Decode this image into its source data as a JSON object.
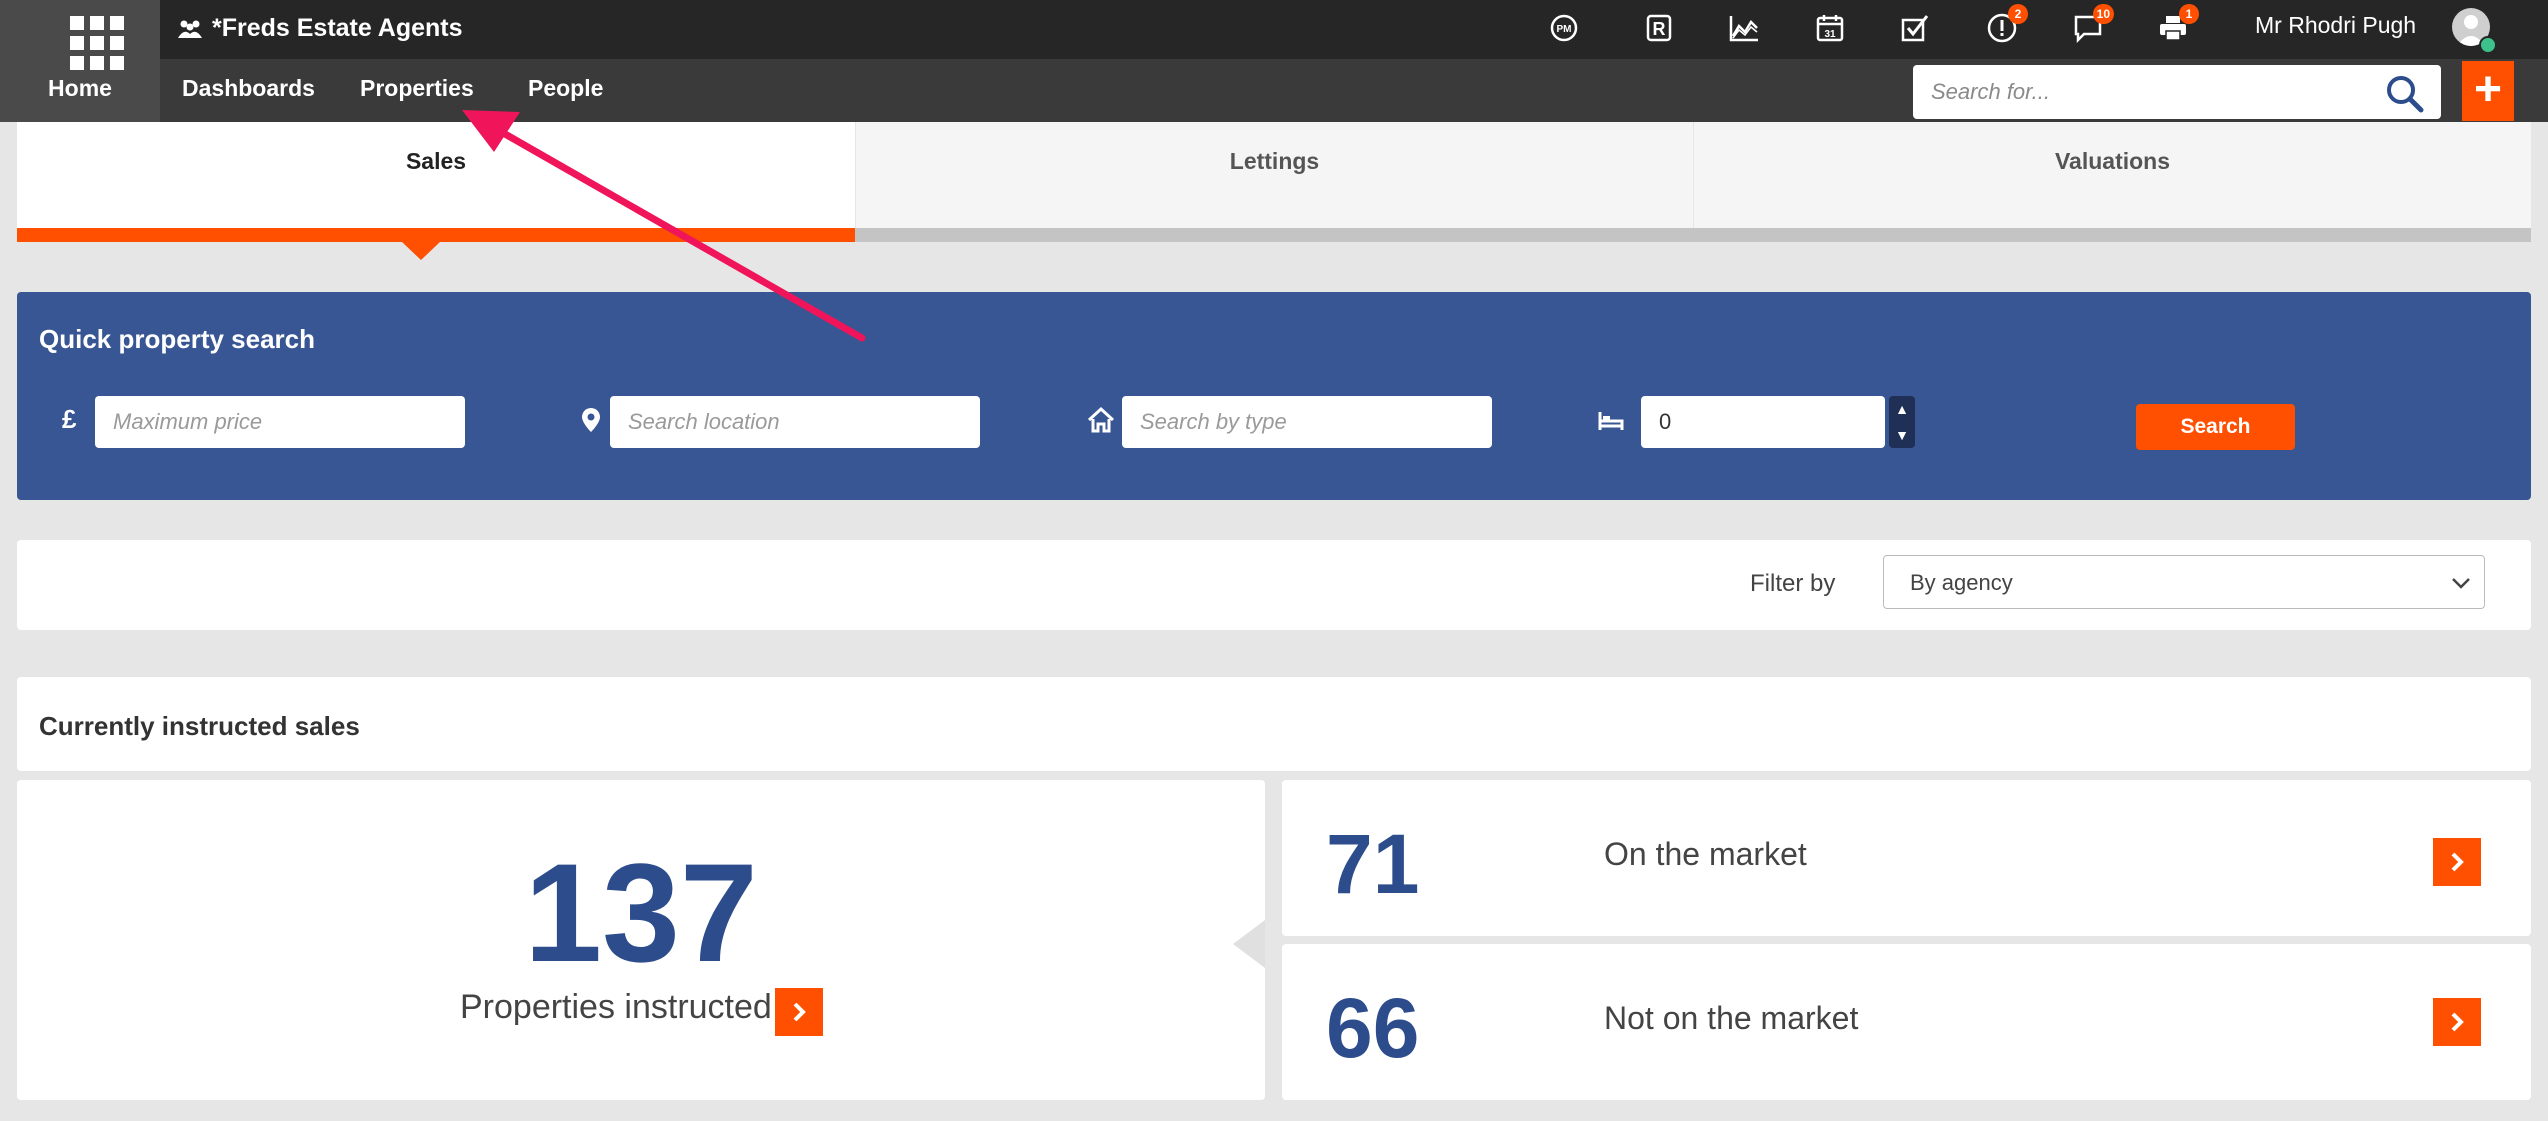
{
  "app": {
    "agency_name": "*Freds Estate Agents"
  },
  "nav": {
    "home_label": "Home",
    "items": [
      {
        "label": "Dashboards"
      },
      {
        "label": "Properties"
      },
      {
        "label": "People"
      }
    ]
  },
  "toolbar": {
    "icons": [
      {
        "name": "property-manager-icon",
        "badge": ""
      },
      {
        "name": "registered-icon",
        "badge": ""
      },
      {
        "name": "chart-icon",
        "badge": ""
      },
      {
        "name": "calendar-icon",
        "badge": ""
      },
      {
        "name": "tasks-icon",
        "badge": ""
      },
      {
        "name": "alerts-icon",
        "badge": "2"
      },
      {
        "name": "messages-icon",
        "badge": "10"
      },
      {
        "name": "print-icon",
        "badge": "1"
      }
    ],
    "user_name": "Mr Rhodri Pugh"
  },
  "search": {
    "placeholder": "Search for...",
    "value": ""
  },
  "tabs": [
    {
      "label": "Sales",
      "active": true
    },
    {
      "label": "Lettings",
      "active": false
    },
    {
      "label": "Valuations",
      "active": false
    }
  ],
  "quick_search": {
    "title": "Quick property search",
    "price_symbol": "£",
    "price_placeholder": "Maximum price",
    "location_placeholder": "Search location",
    "type_placeholder": "Search by type",
    "bedrooms_value": "0",
    "search_label": "Search"
  },
  "filter": {
    "label": "Filter by",
    "selected": "By agency"
  },
  "instructed": {
    "title": "Currently instructed sales",
    "total": "137",
    "total_label": "Properties instructed",
    "on_market": {
      "count": "71",
      "label": "On the market"
    },
    "off_market": {
      "count": "66",
      "label": "Not on the market"
    }
  },
  "colors": {
    "accent": "#ff4f00",
    "brand_blue": "#385694",
    "number_blue": "#2c4c8c",
    "annotation": "#f0145a"
  }
}
